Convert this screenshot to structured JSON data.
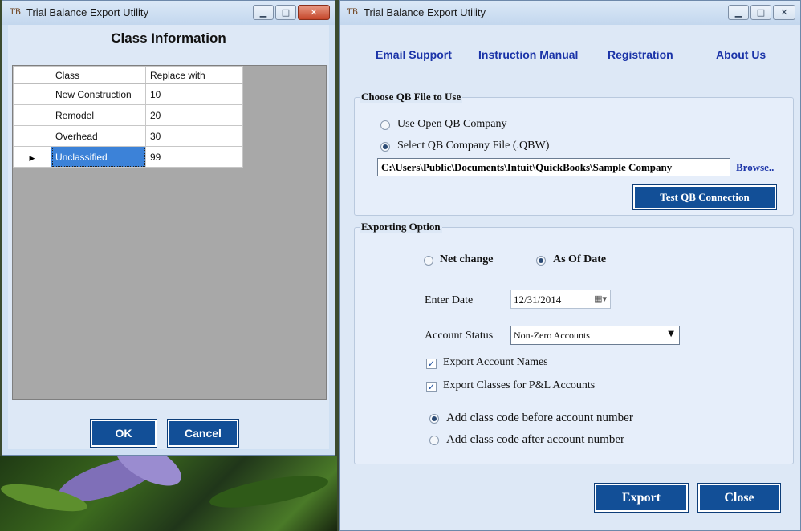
{
  "colors": {
    "accent": "#124f97",
    "link": "#1a33a8",
    "selection": "#3c82d8",
    "window_bg": "#dde8f6"
  },
  "left_window": {
    "title": "Trial Balance Export Utility",
    "heading": "Class Information",
    "columns": [
      "Class",
      "Replace with"
    ],
    "rows": [
      {
        "class": "New Construction",
        "replace": "10"
      },
      {
        "class": "Remodel",
        "replace": "20"
      },
      {
        "class": "Overhead",
        "replace": "30"
      },
      {
        "class": "Unclassified",
        "replace": "99"
      }
    ],
    "current_row_marker": "▶",
    "ok_label": "OK",
    "cancel_label": "Cancel"
  },
  "right_window": {
    "title": "Trial Balance Export Utility",
    "links": {
      "email_support": "Email Support",
      "instruction_manual": "Instruction Manual",
      "registration": "Registration",
      "about_us": "About Us"
    },
    "qb_group": {
      "label": "Choose QB File to Use",
      "option_open": "Use Open QB Company",
      "option_select": "Select QB Company File (.QBW)",
      "selected_option": "select",
      "file_path": "C:\\Users\\Public\\Documents\\Intuit\\QuickBooks\\Sample Company",
      "browse_label": "Browse..",
      "test_button": "Test QB Connection"
    },
    "export_group": {
      "label": "Exporting Option",
      "net_change": "Net change",
      "as_of_date": "As Of Date",
      "selected_mode": "as_of_date",
      "enter_date_label": "Enter Date",
      "date_value": "12/31/2014",
      "account_status_label": "Account Status",
      "account_status_value": "Non-Zero Accounts",
      "export_names_label": "Export Account Names",
      "export_names_checked": true,
      "export_classes_label": "Export Classes for P&L Accounts",
      "export_classes_checked": true,
      "class_before_label": "Add class code before account number",
      "class_after_label": "Add class code after account number",
      "class_position": "before"
    },
    "export_button": "Export",
    "close_button": "Close"
  }
}
